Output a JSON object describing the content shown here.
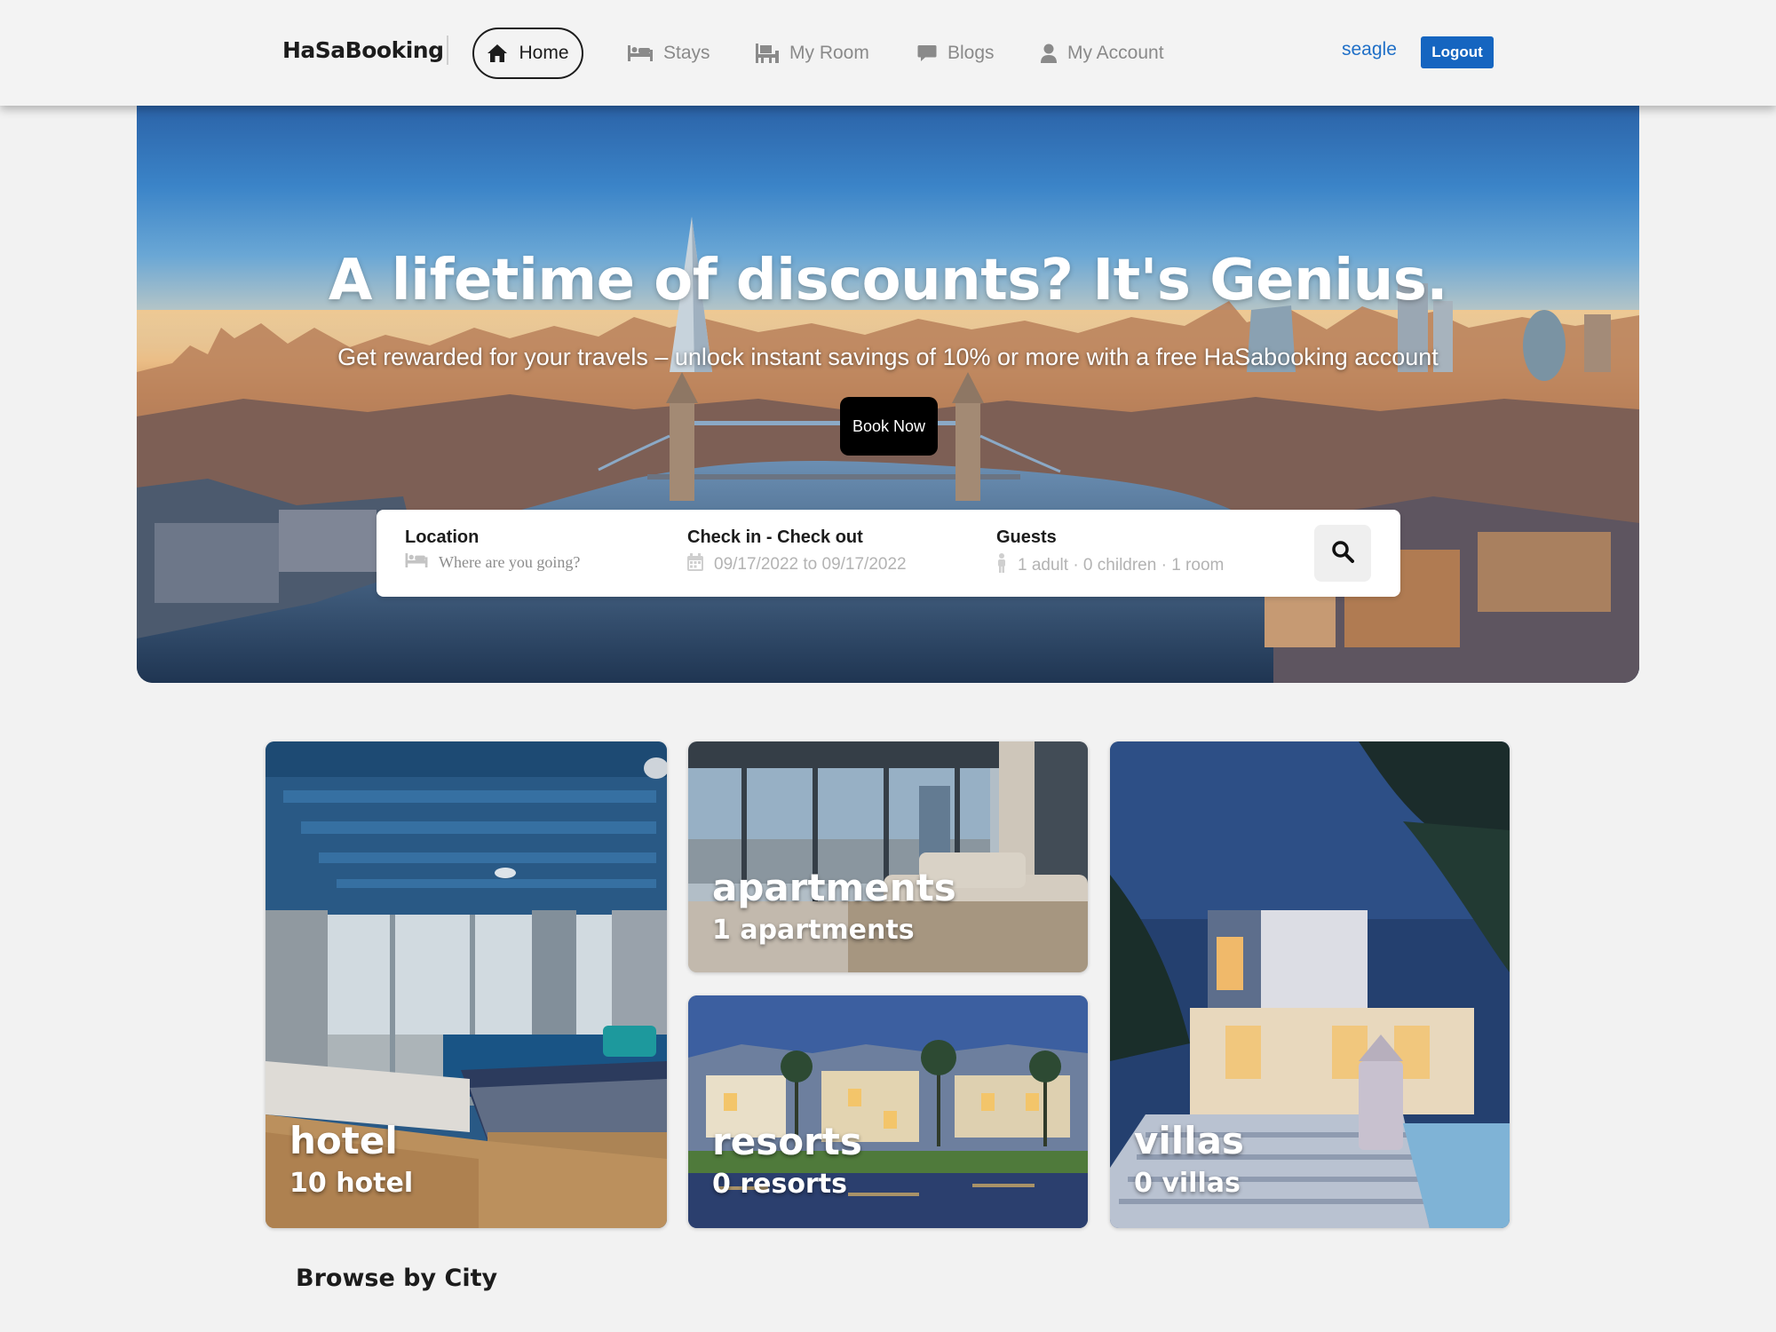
{
  "nav": {
    "brand": "HaSaBooking",
    "home": "Home",
    "items": [
      {
        "label": "Stays",
        "icon": "bed-icon"
      },
      {
        "label": "My Room",
        "icon": "room-icon"
      },
      {
        "label": "Blogs",
        "icon": "comment-icon"
      },
      {
        "label": "My Account",
        "icon": "user-icon"
      }
    ],
    "username": "seagle",
    "logout": "Logout"
  },
  "hero": {
    "title": "A lifetime of discounts? It's Genius.",
    "subtitle": "Get rewarded for your travels – unlock instant savings of 10% or more with a free HaSabooking account",
    "book_now": "Book Now"
  },
  "search": {
    "location_label": "Location",
    "location_placeholder": "Where are you going?",
    "dates_label": "Check in - Check out",
    "dates_value": "09/17/2022 to 09/17/2022",
    "guests_label": "Guests",
    "guests_value": "1 adult · 0 children · 1 room"
  },
  "categories": [
    {
      "title": "hotel",
      "count": "10 hotel"
    },
    {
      "title": "apartments",
      "count": "1 apartments"
    },
    {
      "title": "resorts",
      "count": "0 resorts"
    },
    {
      "title": "villas",
      "count": "0 villas"
    }
  ],
  "browse_heading": "Browse by City",
  "colors": {
    "accent": "#1565c0",
    "link": "#1f6fc7",
    "page_background": "#f2f2f2"
  }
}
